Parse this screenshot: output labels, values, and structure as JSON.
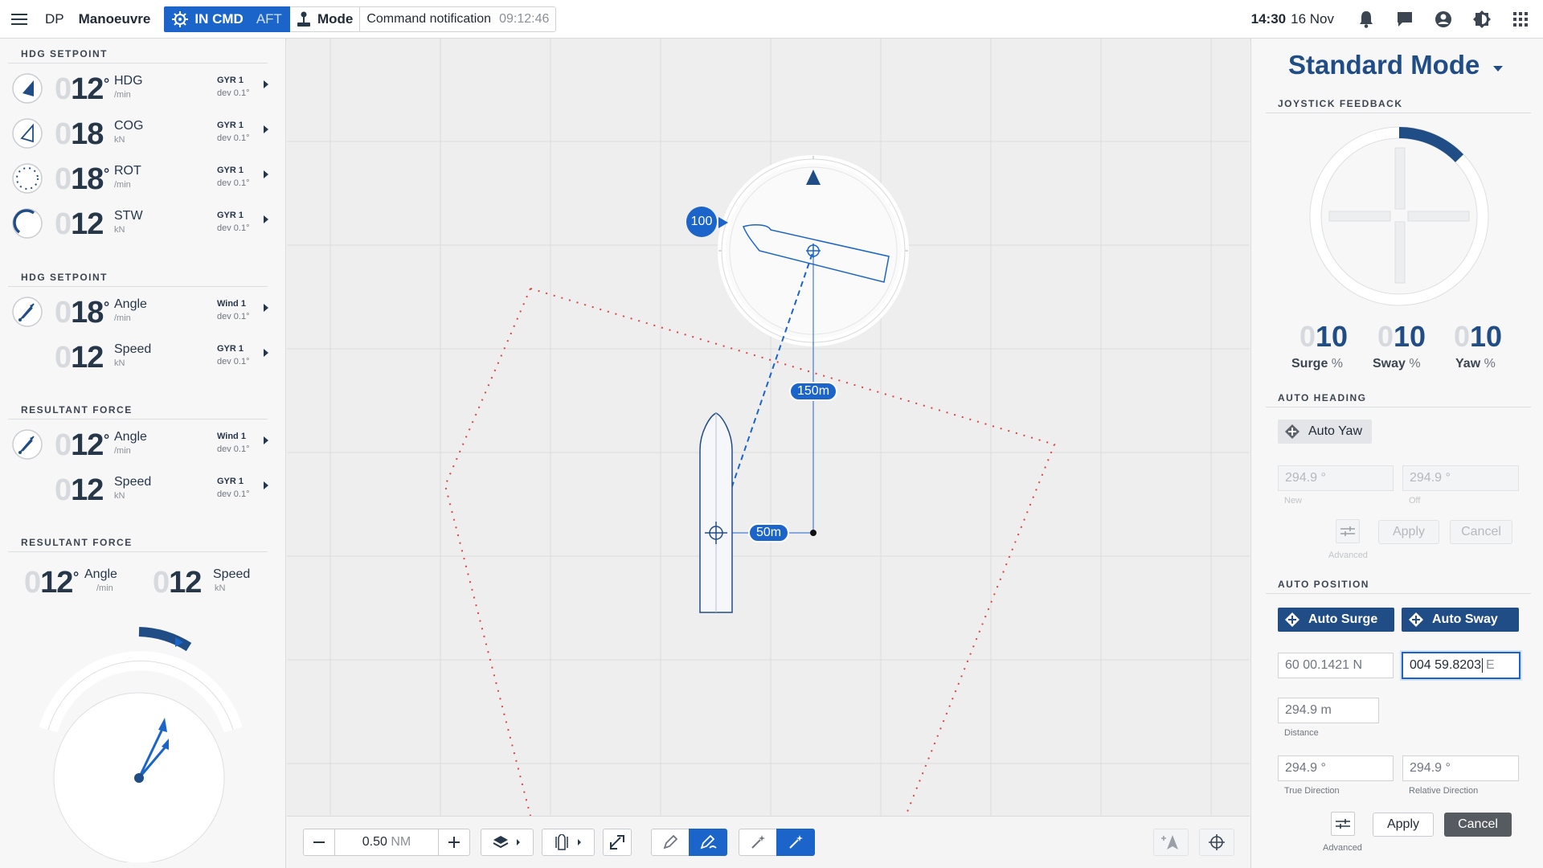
{
  "topbar": {
    "app": "DP",
    "view": "Manoeuvre",
    "in_cmd": "IN CMD",
    "aft": "AFT",
    "mode": "Mode",
    "notification": "Command notification",
    "notification_time": "09:12:46",
    "time": "14:30",
    "date": "16 Nov"
  },
  "left": {
    "sections": [
      "HDG SETPOINT",
      "HDG SETPOINT",
      "RESULTANT FORCE",
      "RESULTANT FORCE"
    ],
    "rows": [
      {
        "ghost": "0",
        "value": "12",
        "deg": "°",
        "label": "HDG",
        "unit": "/min",
        "source": "GYR 1",
        "dev": "dev 0.1°"
      },
      {
        "ghost": "0",
        "value": "18",
        "deg": "",
        "label": "COG",
        "unit": "kN",
        "source": "GYR 1",
        "dev": "dev 0.1°"
      },
      {
        "ghost": "0",
        "value": "18",
        "deg": "°",
        "label": "ROT",
        "unit": "/min",
        "source": "GYR 1",
        "dev": "dev 0.1°"
      },
      {
        "ghost": "0",
        "value": "12",
        "deg": "",
        "label": "STW",
        "unit": "kN",
        "source": "GYR 1",
        "dev": "dev 0.1°"
      },
      {
        "ghost": "0",
        "value": "18",
        "deg": "°",
        "label": "Angle",
        "unit": "/min",
        "source": "Wind 1",
        "dev": "dev 0.1°"
      },
      {
        "ghost": "0",
        "value": "12",
        "deg": "",
        "label": "Speed",
        "unit": "kN",
        "source": "GYR 1",
        "dev": "dev 0.1°"
      },
      {
        "ghost": "0",
        "value": "12",
        "deg": "°",
        "label": "Angle",
        "unit": "/min",
        "source": "Wind 1",
        "dev": "dev 0.1°"
      },
      {
        "ghost": "0",
        "value": "12",
        "deg": "",
        "label": "Speed",
        "unit": "kN",
        "source": "GYR 1",
        "dev": "dev 0.1°"
      }
    ],
    "resultant": {
      "angle": {
        "ghost": "0",
        "value": "12",
        "deg": "°",
        "label": "Angle",
        "unit": "/min"
      },
      "speed": {
        "ghost": "0",
        "value": "12",
        "label": "Speed",
        "unit": "kN"
      }
    }
  },
  "map": {
    "heading_badge": "100",
    "dist_vertical": "150m",
    "dist_horizontal": "50m"
  },
  "bottombar": {
    "zoom_value": "0.50",
    "zoom_unit": "NM"
  },
  "right": {
    "mode_title": "Standard Mode",
    "joystick_title": "JOYSTICK FEEDBACK",
    "feedback": [
      {
        "ghost": "0",
        "value": "10",
        "label": "Surge",
        "unit": "%"
      },
      {
        "ghost": "0",
        "value": "10",
        "label": "Sway",
        "unit": "%"
      },
      {
        "ghost": "0",
        "value": "10",
        "label": "Yaw",
        "unit": "%"
      }
    ],
    "auto_heading_title": "AUTO HEADING",
    "auto_yaw": "Auto Yaw",
    "ah_new": "294.9 °",
    "ah_new_caption": "New",
    "ah_off": "294.9 °",
    "ah_off_caption": "Off",
    "ah_advanced": "Advanced",
    "ah_apply": "Apply",
    "ah_cancel": "Cancel",
    "auto_position_title": "AUTO POSITION",
    "auto_surge": "Auto Surge",
    "auto_sway": "Auto Sway",
    "lat": "60 00.1421 N",
    "lon": "004 59.8203",
    "lon_suffix": "E",
    "distance": "294.9 m",
    "distance_caption": "Distance",
    "true_dir": "294.9 °",
    "true_dir_caption": "True Direction",
    "rel_dir": "294.9 °",
    "rel_dir_caption": "Relative Direction",
    "ap_advanced": "Advanced",
    "ap_apply": "Apply",
    "ap_cancel": "Cancel"
  }
}
